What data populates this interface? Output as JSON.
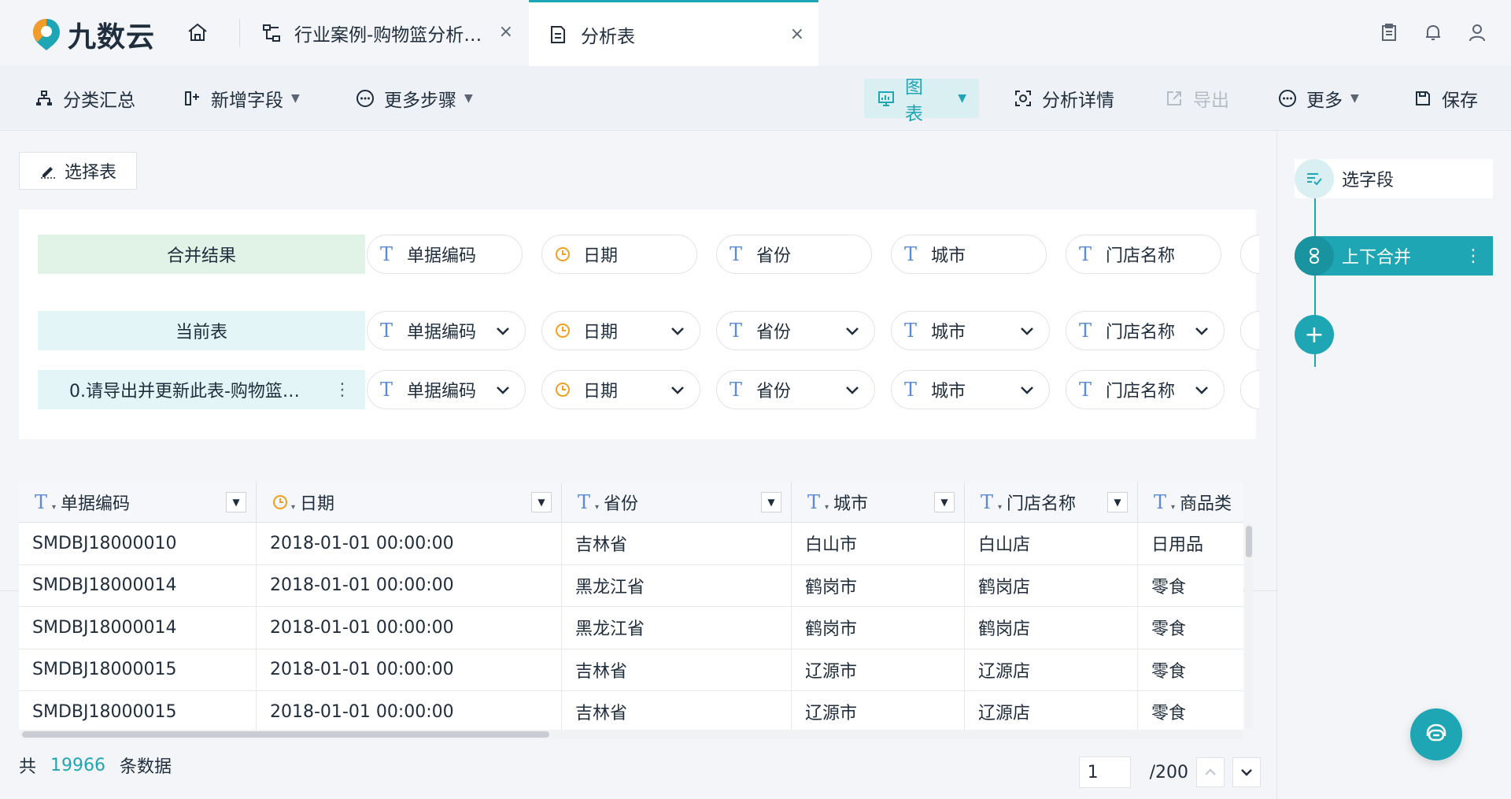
{
  "app": {
    "logo_text": "九数云"
  },
  "tabs": [
    {
      "label": "行业案例-购物篮分析…",
      "close": "×"
    },
    {
      "label": "分析表",
      "close": "×"
    }
  ],
  "toolbar": {
    "classify": "分类汇总",
    "add_field": "新增字段",
    "more_steps": "更多步骤",
    "chart": "图表",
    "analysis_detail": "分析详情",
    "export": "导出",
    "more": "更多",
    "save": "保存"
  },
  "select_table": "选择表",
  "merge": {
    "result_label": "合并结果",
    "current_label": "当前表",
    "source_label": "0.请导出并更新此表-购物篮…",
    "fields": [
      "单据编码",
      "日期",
      "省份",
      "城市",
      "门店名称"
    ],
    "field_types": [
      "text",
      "date",
      "text",
      "text",
      "text"
    ]
  },
  "table": {
    "columns": [
      "单据编码",
      "日期",
      "省份",
      "城市",
      "门店名称",
      "商品类"
    ],
    "column_types": [
      "text",
      "date",
      "text",
      "text",
      "text",
      "text"
    ],
    "rows": [
      [
        "SMDBJ18000010",
        "2018-01-01 00:00:00",
        "吉林省",
        "白山市",
        "白山店",
        "日用品"
      ],
      [
        "SMDBJ18000014",
        "2018-01-01 00:00:00",
        "黑龙江省",
        "鹤岗市",
        "鹤岗店",
        "零食"
      ],
      [
        "SMDBJ18000014",
        "2018-01-01 00:00:00",
        "黑龙江省",
        "鹤岗市",
        "鹤岗店",
        "零食"
      ],
      [
        "SMDBJ18000015",
        "2018-01-01 00:00:00",
        "吉林省",
        "辽源市",
        "辽源店",
        "零食"
      ],
      [
        "SMDBJ18000015",
        "2018-01-01 00:00:00",
        "吉林省",
        "辽源市",
        "辽源店",
        "零食"
      ]
    ]
  },
  "footer": {
    "prefix": "共",
    "count": "19966",
    "suffix": "条数据"
  },
  "pager": {
    "current": "1",
    "total": "/200"
  },
  "steps": {
    "select_fields": "选字段",
    "union": "上下合并",
    "add": "+"
  },
  "colors": {
    "accent": "#1fa6b5",
    "text_icon": "#5b8bd6",
    "date_icon": "#f0a020"
  }
}
